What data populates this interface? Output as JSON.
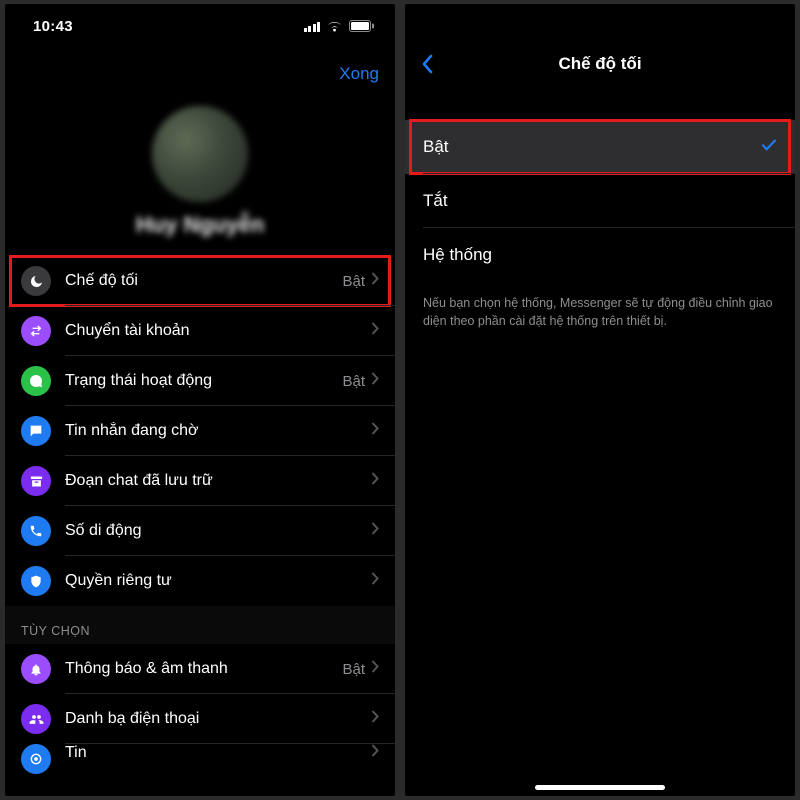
{
  "status": {
    "time": "10:43"
  },
  "left": {
    "nav": {
      "done": "Xong"
    },
    "profile": {
      "name": "Huy Nguyễn"
    },
    "rows": {
      "dark_mode": {
        "label": "Chế độ tối",
        "value": "Bật"
      },
      "switch_acc": {
        "label": "Chuyển tài khoản"
      },
      "active": {
        "label": "Trạng thái hoạt động",
        "value": "Bật"
      },
      "pending": {
        "label": "Tin nhắn đang chờ"
      },
      "archived": {
        "label": "Đoạn chat đã lưu trữ"
      },
      "mobile": {
        "label": "Số di động"
      },
      "privacy": {
        "label": "Quyền riêng tư"
      }
    },
    "section_header": "TÙY CHỌN",
    "rows2": {
      "notif": {
        "label": "Thông báo & âm thanh",
        "value": "Bật"
      },
      "contacts": {
        "label": "Danh bạ điện thoại"
      },
      "tin": {
        "label": "Tin"
      }
    }
  },
  "right": {
    "nav": {
      "title": "Chế độ tối"
    },
    "options": {
      "on": {
        "label": "Bật",
        "selected": true
      },
      "off": {
        "label": "Tắt",
        "selected": false
      },
      "system": {
        "label": "Hệ thống",
        "selected": false
      }
    },
    "footnote": "Nếu bạn chọn hệ thống, Messenger sẽ tự động điều chỉnh giao diện theo phần cài đặt hệ thống trên thiết bị."
  }
}
